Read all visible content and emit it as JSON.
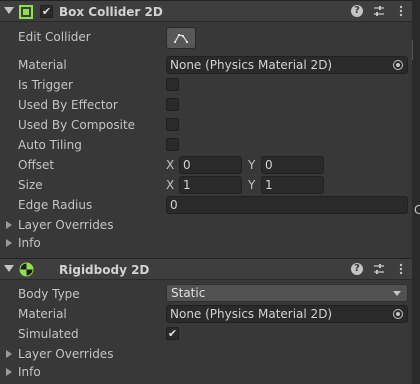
{
  "box_collider": {
    "title": "Box Collider 2D",
    "enabled": "✔",
    "edit_collider_label": "Edit Collider",
    "material_label": "Material",
    "material_value": "None (Physics Material 2D)",
    "is_trigger_label": "Is Trigger",
    "used_by_effector_label": "Used By Effector",
    "used_by_composite_label": "Used By Composite",
    "auto_tiling_label": "Auto Tiling",
    "offset_label": "Offset",
    "offset_x": "0",
    "offset_y": "0",
    "size_label": "Size",
    "size_x": "1",
    "size_y": "1",
    "edge_radius_label": "Edge Radius",
    "edge_radius_value": "0",
    "layer_overrides_label": "Layer Overrides",
    "info_label": "Info",
    "axis_x": "X",
    "axis_y": "Y"
  },
  "rigidbody": {
    "title": "Rigidbody 2D",
    "body_type_label": "Body Type",
    "body_type_value": "Static",
    "material_label": "Material",
    "material_value": "None (Physics Material 2D)",
    "simulated_label": "Simulated",
    "simulated_check": "✔",
    "layer_overrides_label": "Layer Overrides",
    "info_label": "Info"
  },
  "header_icons": {
    "help": "?",
    "presets": "⇅",
    "menu": "⋮"
  },
  "colors": {
    "collider_icon": "#8fe04a",
    "rigidbody_icon": "#8fe04a"
  },
  "clipped_text": "C"
}
